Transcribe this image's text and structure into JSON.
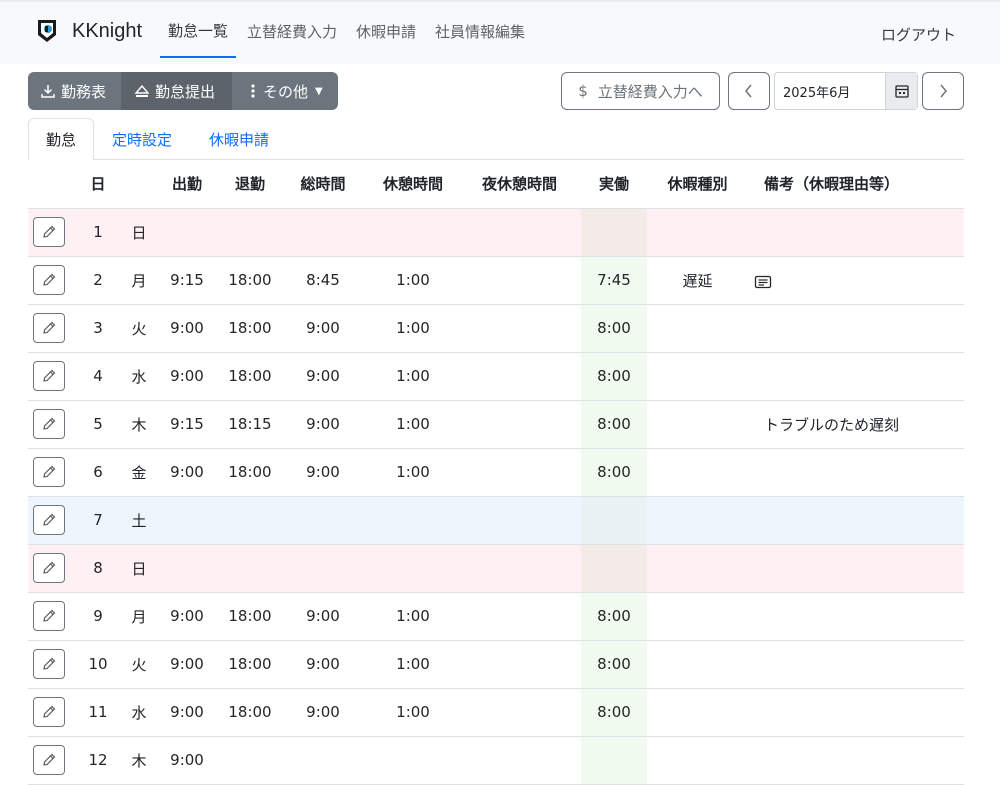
{
  "app": {
    "name": "KKnight"
  },
  "nav": {
    "items": [
      {
        "label": "勤怠一覧"
      },
      {
        "label": "立替経費入力"
      },
      {
        "label": "休暇申請"
      },
      {
        "label": "社員情報編集"
      }
    ],
    "logout": "ログアウト"
  },
  "toolbar": {
    "timesheet": "勤務表",
    "submit": "勤怠提出",
    "more": "その他",
    "expense": "立替経費入力へ",
    "expense_symbol": "$",
    "month": "2025年6月"
  },
  "tabs": [
    {
      "label": "勤怠"
    },
    {
      "label": "定時設定"
    },
    {
      "label": "休暇申請"
    }
  ],
  "table": {
    "headers": [
      "",
      "日",
      "",
      "出勤",
      "退勤",
      "総時間",
      "休憩時間",
      "夜休憩時間",
      "実働",
      "休暇種別",
      "備考（休暇理由等）"
    ],
    "rows": [
      {
        "day": "1",
        "wd": "日",
        "in": "",
        "out": "",
        "total": "",
        "break": "",
        "night": "",
        "work": "",
        "leave": "",
        "remarks": "",
        "memo": false,
        "kind": "sun"
      },
      {
        "day": "2",
        "wd": "月",
        "in": "9:15",
        "out": "18:00",
        "total": "8:45",
        "break": "1:00",
        "night": "",
        "work": "7:45",
        "leave": "遅延",
        "remarks": "",
        "memo": true,
        "kind": ""
      },
      {
        "day": "3",
        "wd": "火",
        "in": "9:00",
        "out": "18:00",
        "total": "9:00",
        "break": "1:00",
        "night": "",
        "work": "8:00",
        "leave": "",
        "remarks": "",
        "memo": false,
        "kind": ""
      },
      {
        "day": "4",
        "wd": "水",
        "in": "9:00",
        "out": "18:00",
        "total": "9:00",
        "break": "1:00",
        "night": "",
        "work": "8:00",
        "leave": "",
        "remarks": "",
        "memo": false,
        "kind": ""
      },
      {
        "day": "5",
        "wd": "木",
        "in": "9:15",
        "out": "18:15",
        "total": "9:00",
        "break": "1:00",
        "night": "",
        "work": "8:00",
        "leave": "",
        "remarks": "トラブルのため遅刻",
        "memo": false,
        "kind": ""
      },
      {
        "day": "6",
        "wd": "金",
        "in": "9:00",
        "out": "18:00",
        "total": "9:00",
        "break": "1:00",
        "night": "",
        "work": "8:00",
        "leave": "",
        "remarks": "",
        "memo": false,
        "kind": ""
      },
      {
        "day": "7",
        "wd": "土",
        "in": "",
        "out": "",
        "total": "",
        "break": "",
        "night": "",
        "work": "",
        "leave": "",
        "remarks": "",
        "memo": false,
        "kind": "sat"
      },
      {
        "day": "8",
        "wd": "日",
        "in": "",
        "out": "",
        "total": "",
        "break": "",
        "night": "",
        "work": "",
        "leave": "",
        "remarks": "",
        "memo": false,
        "kind": "sun"
      },
      {
        "day": "9",
        "wd": "月",
        "in": "9:00",
        "out": "18:00",
        "total": "9:00",
        "break": "1:00",
        "night": "",
        "work": "8:00",
        "leave": "",
        "remarks": "",
        "memo": false,
        "kind": ""
      },
      {
        "day": "10",
        "wd": "火",
        "in": "9:00",
        "out": "18:00",
        "total": "9:00",
        "break": "1:00",
        "night": "",
        "work": "8:00",
        "leave": "",
        "remarks": "",
        "memo": false,
        "kind": ""
      },
      {
        "day": "11",
        "wd": "水",
        "in": "9:00",
        "out": "18:00",
        "total": "9:00",
        "break": "1:00",
        "night": "",
        "work": "8:00",
        "leave": "",
        "remarks": "",
        "memo": false,
        "kind": ""
      },
      {
        "day": "12",
        "wd": "木",
        "in": "9:00",
        "out": "",
        "total": "",
        "break": "",
        "night": "",
        "work": "",
        "leave": "",
        "remarks": "",
        "memo": false,
        "kind": ""
      }
    ]
  }
}
